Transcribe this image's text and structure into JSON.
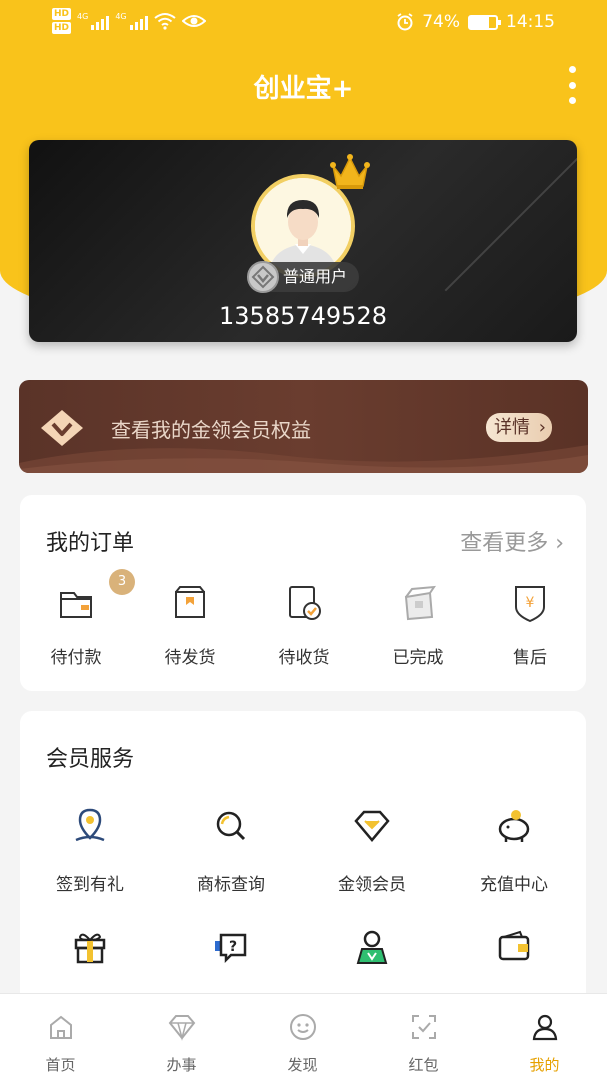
{
  "status_bar": {
    "hd1": "HD",
    "hd2": "HD",
    "net1": "4G",
    "net2": "4G",
    "battery": "74%",
    "battery_level": 0.74,
    "time": "14:15"
  },
  "header": {
    "title": "创业宝+"
  },
  "profile": {
    "user_type": "普通用户",
    "phone": "13585749528"
  },
  "member_banner": {
    "text": "查看我的金领会员权益",
    "detail": "详情",
    "detail_chevron": "›"
  },
  "orders": {
    "title": "我的订单",
    "see_more": "查看更多 ›",
    "items": [
      {
        "label": "待付款",
        "badge": "3",
        "icon": "wallet-icon"
      },
      {
        "label": "待发货",
        "icon": "package-icon"
      },
      {
        "label": "待收货",
        "icon": "receive-icon"
      },
      {
        "label": "已完成",
        "icon": "box-icon"
      },
      {
        "label": "售后",
        "icon": "shield-icon"
      }
    ]
  },
  "services": {
    "title": "会员服务",
    "items": [
      {
        "label": "签到有礼",
        "icon": "location-pin-icon"
      },
      {
        "label": "商标查询",
        "icon": "search-icon"
      },
      {
        "label": "金领会员",
        "icon": "diamond-icon"
      },
      {
        "label": "充值中心",
        "icon": "piggy-bank-icon"
      },
      {
        "label": "",
        "icon": "gift-icon"
      },
      {
        "label": "",
        "icon": "help-chat-icon"
      },
      {
        "label": "",
        "icon": "user-card-icon"
      },
      {
        "label": "",
        "icon": "wallet-icon"
      }
    ]
  },
  "bottom_nav": {
    "items": [
      {
        "label": "首页",
        "icon": "home-icon"
      },
      {
        "label": "办事",
        "icon": "diamond-icon"
      },
      {
        "label": "发现",
        "icon": "smile-icon"
      },
      {
        "label": "红包",
        "icon": "scan-icon"
      },
      {
        "label": "我的",
        "icon": "person-icon",
        "active": true
      }
    ]
  },
  "colors": {
    "brand_yellow": "#f9c31b",
    "accent_orange": "#e6a100",
    "badge": "#d9b27a",
    "banner_brown": "#5a3328"
  }
}
